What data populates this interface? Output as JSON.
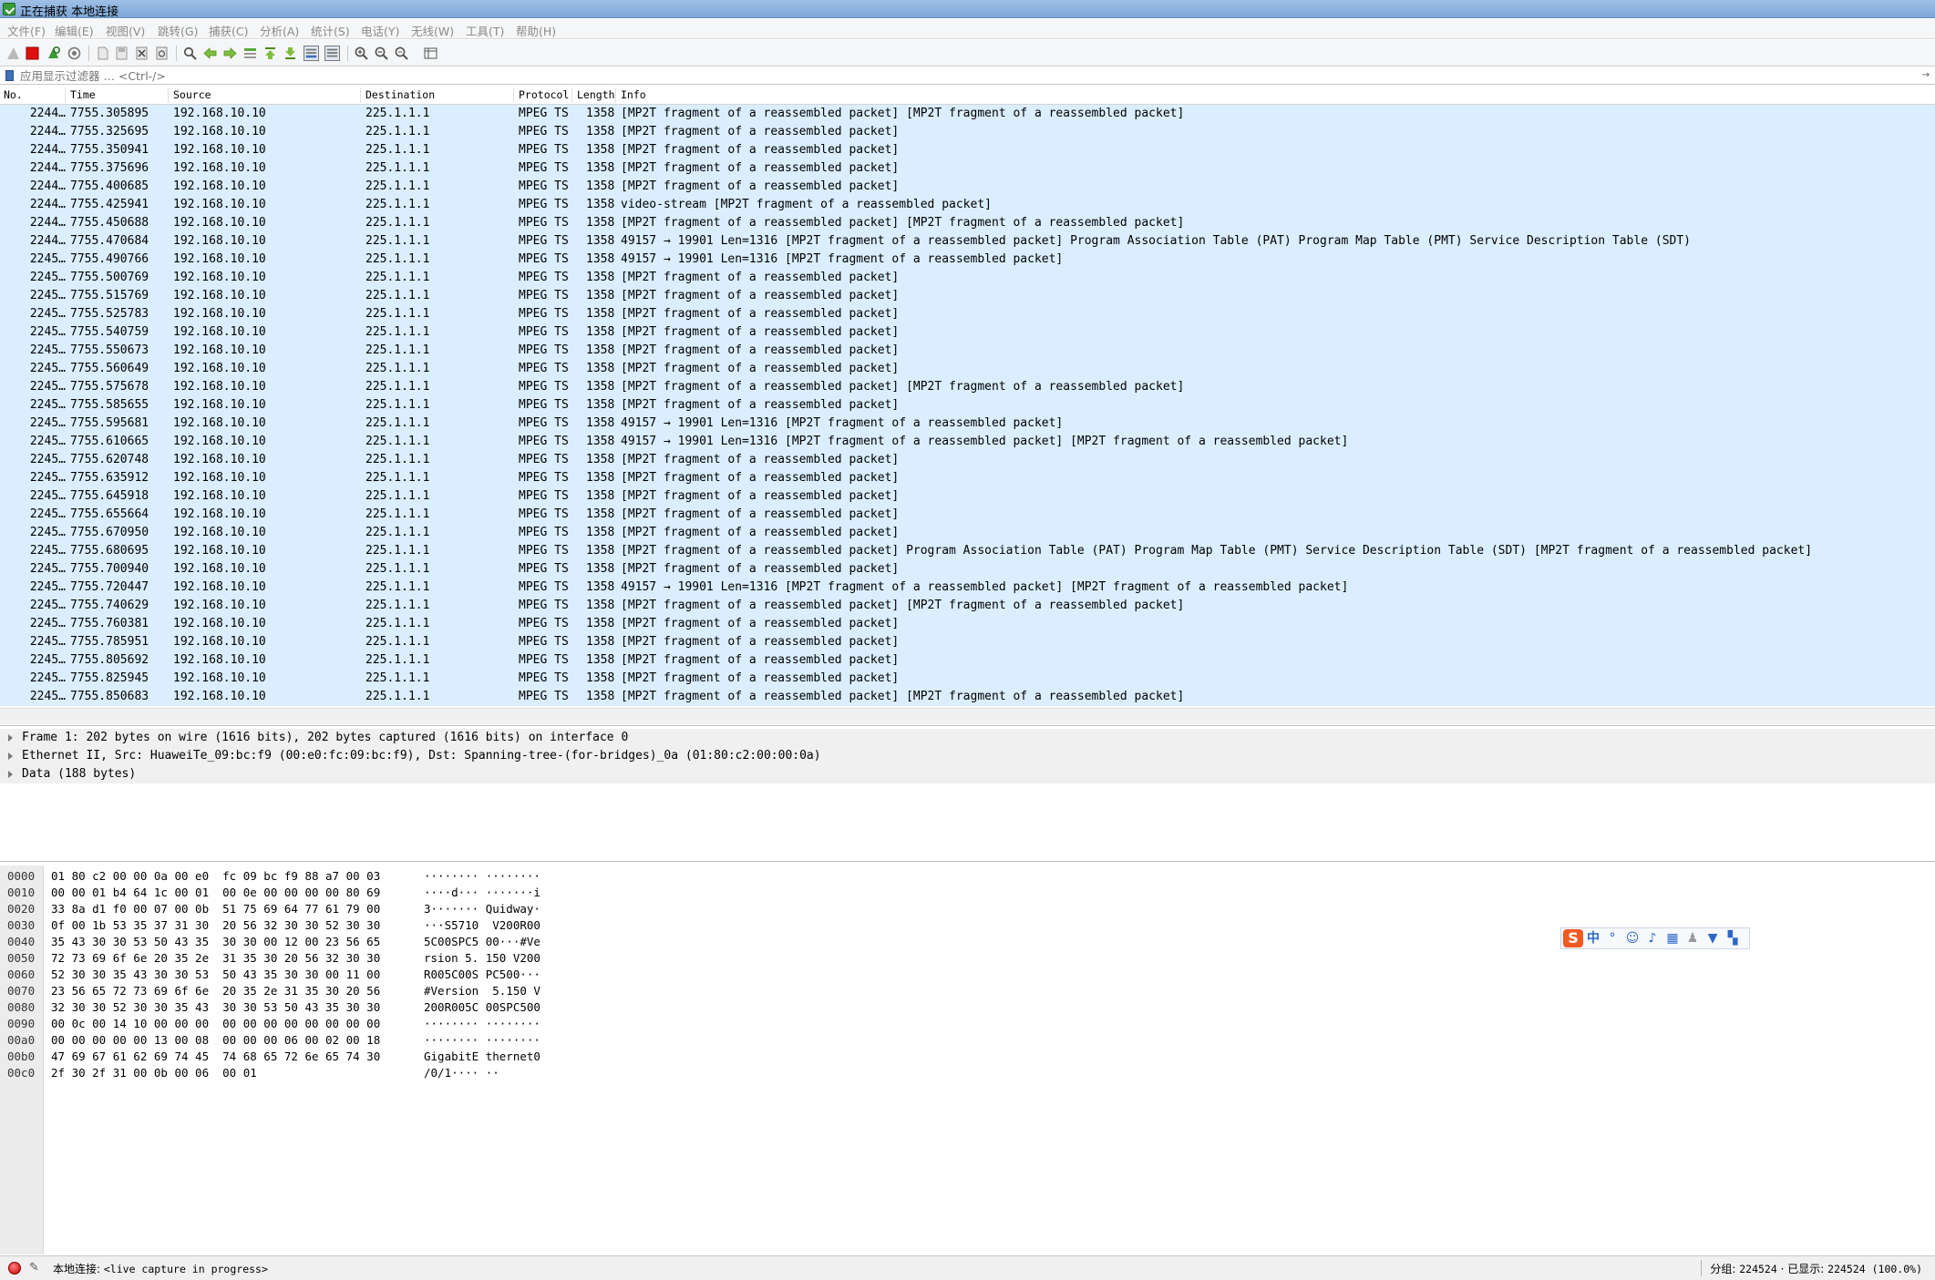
{
  "window": {
    "title": "正在捕获 本地连接"
  },
  "menu": [
    "文件(F)",
    "编辑(E)",
    "视图(V)",
    "跳转(G)",
    "捕获(C)",
    "分析(A)",
    "统计(S)",
    "电话(Y)",
    "无线(W)",
    "工具(T)",
    "帮助(H)"
  ],
  "filter": {
    "placeholder": "应用显示过滤器 … <Ctrl-/>"
  },
  "columns": [
    "No.",
    "Time",
    "Source",
    "Destination",
    "Protocol",
    "Length",
    "Info"
  ],
  "packets": [
    {
      "no": "2244…",
      "time": "7755.305895",
      "src": "192.168.10.10",
      "dst": "225.1.1.1",
      "proto": "MPEG TS",
      "len": "1358",
      "info": "[MP2T fragment of a reassembled packet] [MP2T fragment of a reassembled packet]"
    },
    {
      "no": "2244…",
      "time": "7755.325695",
      "src": "192.168.10.10",
      "dst": "225.1.1.1",
      "proto": "MPEG TS",
      "len": "1358",
      "info": "[MP2T fragment of a reassembled packet]"
    },
    {
      "no": "2244…",
      "time": "7755.350941",
      "src": "192.168.10.10",
      "dst": "225.1.1.1",
      "proto": "MPEG TS",
      "len": "1358",
      "info": "[MP2T fragment of a reassembled packet]"
    },
    {
      "no": "2244…",
      "time": "7755.375696",
      "src": "192.168.10.10",
      "dst": "225.1.1.1",
      "proto": "MPEG TS",
      "len": "1358",
      "info": "[MP2T fragment of a reassembled packet]"
    },
    {
      "no": "2244…",
      "time": "7755.400685",
      "src": "192.168.10.10",
      "dst": "225.1.1.1",
      "proto": "MPEG TS",
      "len": "1358",
      "info": "[MP2T fragment of a reassembled packet]"
    },
    {
      "no": "2244…",
      "time": "7755.425941",
      "src": "192.168.10.10",
      "dst": "225.1.1.1",
      "proto": "MPEG TS",
      "len": "1358",
      "info": "video-stream  [MP2T fragment of a reassembled packet]"
    },
    {
      "no": "2244…",
      "time": "7755.450688",
      "src": "192.168.10.10",
      "dst": "225.1.1.1",
      "proto": "MPEG TS",
      "len": "1358",
      "info": "[MP2T fragment of a reassembled packet] [MP2T fragment of a reassembled packet]"
    },
    {
      "no": "2244…",
      "time": "7755.470684",
      "src": "192.168.10.10",
      "dst": "225.1.1.1",
      "proto": "MPEG TS",
      "len": "1358",
      "info": "49157 → 19901 Len=1316 [MP2T fragment of a reassembled packet] Program Association Table (PAT) Program Map Table (PMT) Service Description Table (SDT)"
    },
    {
      "no": "2245…",
      "time": "7755.490766",
      "src": "192.168.10.10",
      "dst": "225.1.1.1",
      "proto": "MPEG TS",
      "len": "1358",
      "info": "49157 → 19901 Len=1316 [MP2T fragment of a reassembled packet]"
    },
    {
      "no": "2245…",
      "time": "7755.500769",
      "src": "192.168.10.10",
      "dst": "225.1.1.1",
      "proto": "MPEG TS",
      "len": "1358",
      "info": "[MP2T fragment of a reassembled packet]"
    },
    {
      "no": "2245…",
      "time": "7755.515769",
      "src": "192.168.10.10",
      "dst": "225.1.1.1",
      "proto": "MPEG TS",
      "len": "1358",
      "info": "[MP2T fragment of a reassembled packet]"
    },
    {
      "no": "2245…",
      "time": "7755.525783",
      "src": "192.168.10.10",
      "dst": "225.1.1.1",
      "proto": "MPEG TS",
      "len": "1358",
      "info": "[MP2T fragment of a reassembled packet]"
    },
    {
      "no": "2245…",
      "time": "7755.540759",
      "src": "192.168.10.10",
      "dst": "225.1.1.1",
      "proto": "MPEG TS",
      "len": "1358",
      "info": "[MP2T fragment of a reassembled packet]"
    },
    {
      "no": "2245…",
      "time": "7755.550673",
      "src": "192.168.10.10",
      "dst": "225.1.1.1",
      "proto": "MPEG TS",
      "len": "1358",
      "info": "[MP2T fragment of a reassembled packet]"
    },
    {
      "no": "2245…",
      "time": "7755.560649",
      "src": "192.168.10.10",
      "dst": "225.1.1.1",
      "proto": "MPEG TS",
      "len": "1358",
      "info": "[MP2T fragment of a reassembled packet]"
    },
    {
      "no": "2245…",
      "time": "7755.575678",
      "src": "192.168.10.10",
      "dst": "225.1.1.1",
      "proto": "MPEG TS",
      "len": "1358",
      "info": "[MP2T fragment of a reassembled packet] [MP2T fragment of a reassembled packet]"
    },
    {
      "no": "2245…",
      "time": "7755.585655",
      "src": "192.168.10.10",
      "dst": "225.1.1.1",
      "proto": "MPEG TS",
      "len": "1358",
      "info": "[MP2T fragment of a reassembled packet]"
    },
    {
      "no": "2245…",
      "time": "7755.595681",
      "src": "192.168.10.10",
      "dst": "225.1.1.1",
      "proto": "MPEG TS",
      "len": "1358",
      "info": "49157 → 19901 Len=1316 [MP2T fragment of a reassembled packet]"
    },
    {
      "no": "2245…",
      "time": "7755.610665",
      "src": "192.168.10.10",
      "dst": "225.1.1.1",
      "proto": "MPEG TS",
      "len": "1358",
      "info": "49157 → 19901 Len=1316 [MP2T fragment of a reassembled packet] [MP2T fragment of a reassembled packet]"
    },
    {
      "no": "2245…",
      "time": "7755.620748",
      "src": "192.168.10.10",
      "dst": "225.1.1.1",
      "proto": "MPEG TS",
      "len": "1358",
      "info": "[MP2T fragment of a reassembled packet]"
    },
    {
      "no": "2245…",
      "time": "7755.635912",
      "src": "192.168.10.10",
      "dst": "225.1.1.1",
      "proto": "MPEG TS",
      "len": "1358",
      "info": "[MP2T fragment of a reassembled packet]"
    },
    {
      "no": "2245…",
      "time": "7755.645918",
      "src": "192.168.10.10",
      "dst": "225.1.1.1",
      "proto": "MPEG TS",
      "len": "1358",
      "info": "[MP2T fragment of a reassembled packet]"
    },
    {
      "no": "2245…",
      "time": "7755.655664",
      "src": "192.168.10.10",
      "dst": "225.1.1.1",
      "proto": "MPEG TS",
      "len": "1358",
      "info": "[MP2T fragment of a reassembled packet]"
    },
    {
      "no": "2245…",
      "time": "7755.670950",
      "src": "192.168.10.10",
      "dst": "225.1.1.1",
      "proto": "MPEG TS",
      "len": "1358",
      "info": "[MP2T fragment of a reassembled packet]"
    },
    {
      "no": "2245…",
      "time": "7755.680695",
      "src": "192.168.10.10",
      "dst": "225.1.1.1",
      "proto": "MPEG TS",
      "len": "1358",
      "info": "[MP2T fragment of a reassembled packet] Program Association Table (PAT) Program Map Table (PMT) Service Description Table (SDT) [MP2T fragment of a reassembled packet]"
    },
    {
      "no": "2245…",
      "time": "7755.700940",
      "src": "192.168.10.10",
      "dst": "225.1.1.1",
      "proto": "MPEG TS",
      "len": "1358",
      "info": "[MP2T fragment of a reassembled packet]"
    },
    {
      "no": "2245…",
      "time": "7755.720447",
      "src": "192.168.10.10",
      "dst": "225.1.1.1",
      "proto": "MPEG TS",
      "len": "1358",
      "info": "49157 → 19901 Len=1316 [MP2T fragment of a reassembled packet] [MP2T fragment of a reassembled packet]"
    },
    {
      "no": "2245…",
      "time": "7755.740629",
      "src": "192.168.10.10",
      "dst": "225.1.1.1",
      "proto": "MPEG TS",
      "len": "1358",
      "info": "[MP2T fragment of a reassembled packet] [MP2T fragment of a reassembled packet]"
    },
    {
      "no": "2245…",
      "time": "7755.760381",
      "src": "192.168.10.10",
      "dst": "225.1.1.1",
      "proto": "MPEG TS",
      "len": "1358",
      "info": "[MP2T fragment of a reassembled packet]"
    },
    {
      "no": "2245…",
      "time": "7755.785951",
      "src": "192.168.10.10",
      "dst": "225.1.1.1",
      "proto": "MPEG TS",
      "len": "1358",
      "info": "[MP2T fragment of a reassembled packet]"
    },
    {
      "no": "2245…",
      "time": "7755.805692",
      "src": "192.168.10.10",
      "dst": "225.1.1.1",
      "proto": "MPEG TS",
      "len": "1358",
      "info": "[MP2T fragment of a reassembled packet]"
    },
    {
      "no": "2245…",
      "time": "7755.825945",
      "src": "192.168.10.10",
      "dst": "225.1.1.1",
      "proto": "MPEG TS",
      "len": "1358",
      "info": "[MP2T fragment of a reassembled packet]"
    },
    {
      "no": "2245…",
      "time": "7755.850683",
      "src": "192.168.10.10",
      "dst": "225.1.1.1",
      "proto": "MPEG TS",
      "len": "1358",
      "info": "[MP2T fragment of a reassembled packet] [MP2T fragment of a reassembled packet]"
    }
  ],
  "details": [
    "Frame 1: 202 bytes on wire (1616 bits), 202 bytes captured (1616 bits) on interface 0",
    "Ethernet II, Src: HuaweiTe_09:bc:f9 (00:e0:fc:09:bc:f9), Dst: Spanning-tree-(for-bridges)_0a (01:80:c2:00:00:0a)",
    "Data (188 bytes)"
  ],
  "bytes": [
    {
      "off": "0000",
      "hex": "01 80 c2 00 00 0a 00 e0  fc 09 bc f9 88 a7 00 03",
      "ascii": "········ ········"
    },
    {
      "off": "0010",
      "hex": "00 00 01 b4 64 1c 00 01  00 0e 00 00 00 00 80 69",
      "ascii": "····d··· ·······i"
    },
    {
      "off": "0020",
      "hex": "33 8a d1 f0 00 07 00 0b  51 75 69 64 77 61 79 00",
      "ascii": "3······· Quidway·"
    },
    {
      "off": "0030",
      "hex": "0f 00 1b 53 35 37 31 30  20 56 32 30 30 52 30 30",
      "ascii": "···S5710  V200R00"
    },
    {
      "off": "0040",
      "hex": "35 43 30 30 53 50 43 35  30 30 00 12 00 23 56 65",
      "ascii": "5C00SPC5 00···#Ve"
    },
    {
      "off": "0050",
      "hex": "72 73 69 6f 6e 20 35 2e  31 35 30 20 56 32 30 30",
      "ascii": "rsion 5. 150 V200"
    },
    {
      "off": "0060",
      "hex": "52 30 30 35 43 30 30 53  50 43 35 30 30 00 11 00",
      "ascii": "R005C00S PC500···"
    },
    {
      "off": "0070",
      "hex": "23 56 65 72 73 69 6f 6e  20 35 2e 31 35 30 20 56",
      "ascii": "#Version  5.150 V"
    },
    {
      "off": "0080",
      "hex": "32 30 30 52 30 30 35 43  30 30 53 50 43 35 30 30",
      "ascii": "200R005C 00SPC500"
    },
    {
      "off": "0090",
      "hex": "00 0c 00 14 10 00 00 00  00 00 00 00 00 00 00 00",
      "ascii": "········ ········"
    },
    {
      "off": "00a0",
      "hex": "00 00 00 00 00 13 00 08  00 00 00 06 00 02 00 18",
      "ascii": "········ ········"
    },
    {
      "off": "00b0",
      "hex": "47 69 67 61 62 69 74 45  74 68 65 72 6e 65 74 30",
      "ascii": "GigabitE thernet0"
    },
    {
      "off": "00c0",
      "hex": "2f 30 2f 31 00 0b 00 06  00 01",
      "ascii": "/0/1···· ··"
    }
  ],
  "ime": {
    "logo": "S",
    "mode": "中"
  },
  "status": {
    "interface": "本地连接:",
    "capture_state": "<live capture in progress>",
    "packets_label": "分组:",
    "packets_value": "224524",
    "dot": "·",
    "shown_label": "已显示:",
    "shown_value": "224524 (100.0%)"
  },
  "colors": {
    "row_bg": "#daeeff",
    "titlebar": "#7ea6d6",
    "status_dot": "#c00000"
  }
}
